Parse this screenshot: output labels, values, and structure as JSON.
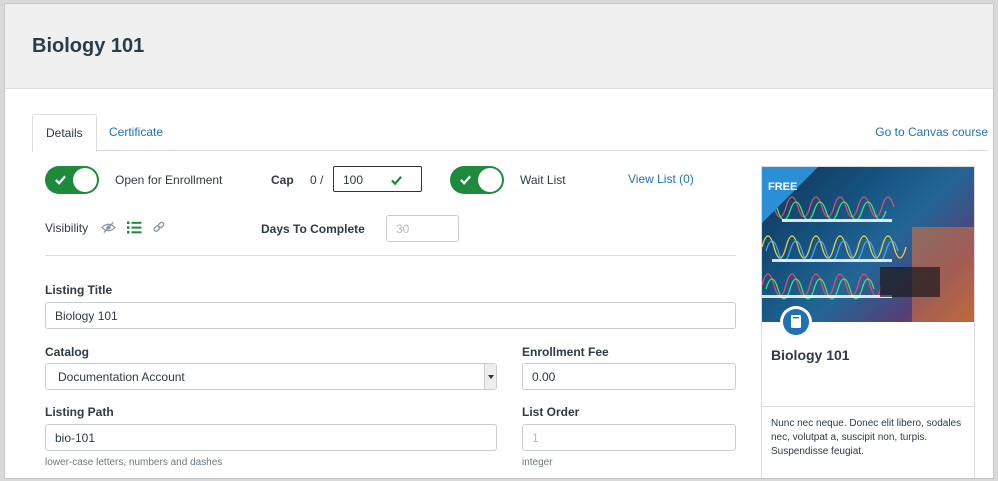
{
  "header": {
    "title": "Biology 101"
  },
  "tabs": [
    {
      "label": "Details",
      "active": true
    },
    {
      "label": "Certificate",
      "active": false
    }
  ],
  "go_to_canvas": "Go to Canvas course",
  "enrollment": {
    "open_label": "Open for Enrollment",
    "open_on": true,
    "cap_label": "Cap",
    "cap_count": "0 /",
    "cap_value": "100",
    "waitlist_label": "Wait List",
    "waitlist_on": true,
    "view_list_label": "View List (0)"
  },
  "visibility": {
    "label": "Visibility",
    "icons": [
      "eye-slash-icon",
      "list-icon",
      "link-icon"
    ]
  },
  "days_to_complete": {
    "label": "Days To Complete",
    "placeholder": "30"
  },
  "listing_title": {
    "label": "Listing Title",
    "value": "Biology 101"
  },
  "catalog": {
    "label": "Catalog",
    "value": "Documentation Account"
  },
  "enrollment_fee": {
    "label": "Enrollment Fee",
    "value": "0.00"
  },
  "listing_path": {
    "label": "Listing Path",
    "value": "bio-101",
    "hint": "lower-case letters, numbers and dashes"
  },
  "list_order": {
    "label": "List Order",
    "placeholder": "1",
    "hint": "integer"
  },
  "card": {
    "badge": "FREE",
    "title": "Biology 101",
    "description": "Nunc nec neque. Donec elit libero, sodales nec, volutpat a, suscipit non, turpis. Suspendisse feugiat."
  },
  "colors": {
    "toggle_on": "#1e8a3c",
    "link": "#2170b5",
    "header_bg": "#f0f0f0"
  }
}
